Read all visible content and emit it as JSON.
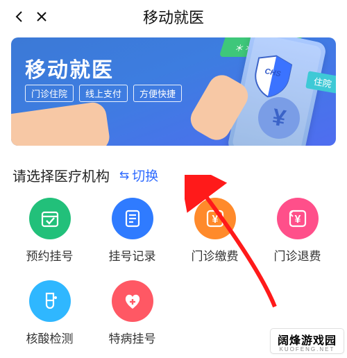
{
  "header": {
    "title": "移动就医"
  },
  "banner": {
    "title": "移动就医",
    "ribbon": "＊＊---＊＊",
    "tags": [
      "门诊住院",
      "线上支付",
      "方便快捷"
    ],
    "shield_label": "CHS",
    "hospital_badge": "住院"
  },
  "section": {
    "title": "请选择医疗机构",
    "switch_label": "切换"
  },
  "icons": {
    "colors": {
      "green": "#22c07a",
      "blue": "#2f7bff",
      "orange": "#ff8a2b",
      "pink": "#ff4f8a",
      "cyan": "#2fb7ff",
      "red": "#ff5864"
    }
  },
  "grid": [
    {
      "id": "appointment",
      "label": "预约挂号",
      "color": "green"
    },
    {
      "id": "records",
      "label": "挂号记录",
      "color": "blue"
    },
    {
      "id": "outpatient-pay",
      "label": "门诊缴费",
      "color": "orange"
    },
    {
      "id": "outpatient-refund",
      "label": "门诊退费",
      "color": "pink"
    },
    {
      "id": "nucleic-test",
      "label": "核酸检测",
      "color": "cyan"
    },
    {
      "id": "special-reg",
      "label": "特病挂号",
      "color": "red"
    }
  ],
  "watermark": {
    "title": "阔烽游戏园",
    "sub": "KUOFENG.NET"
  }
}
